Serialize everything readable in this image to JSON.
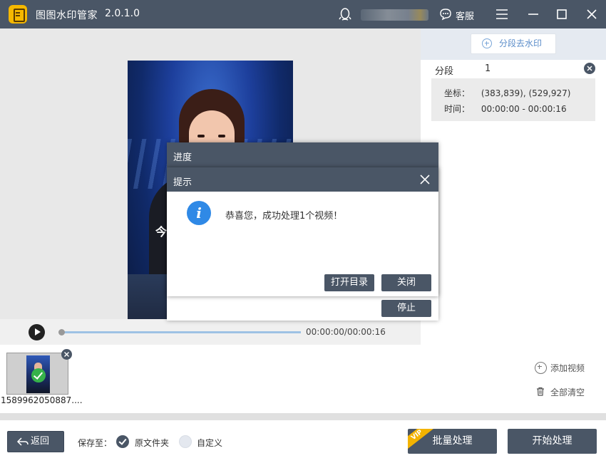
{
  "titlebar": {
    "app_name": "图图水印管家",
    "version": "2.0.1.0",
    "service_label": "客服",
    "qq_icon": "qq-penguin-icon",
    "service_icon": "chat-bubble-icon"
  },
  "right_panel": {
    "segment_button": "分段去水印",
    "segment_label": "分段",
    "segment_number": "1",
    "coord_key": "坐标：",
    "coord_value": "(383,839), (529,927)",
    "time_key": "时间：",
    "time_value": "00:00:00 - 00:00:16"
  },
  "preview": {
    "caption_char": "今"
  },
  "player": {
    "time_readout": "00:00:00/00:00:16"
  },
  "progress_dialog": {
    "title": "进度",
    "stop_label": "停止"
  },
  "message_dialog": {
    "title": "提示",
    "message": "恭喜您，成功处理1个视频！",
    "open_dir_label": "打开目录",
    "close_label": "关闭",
    "info_icon": "i"
  },
  "file_list": {
    "items": [
      {
        "name": "1589962050887...."
      }
    ],
    "add_video_label": "添加视频",
    "clear_all_label": "全部清空"
  },
  "footer": {
    "back_label": "返回",
    "save_to_label": "保存至：",
    "option_original": "原文件夹",
    "option_custom": "自定义",
    "selected_option": "原文件夹",
    "batch_label": "批量处理",
    "vip_badge": "VIP",
    "start_label": "开始处理"
  },
  "colors": {
    "header": "#4a5666",
    "accent_blue": "#2f89e6",
    "success_green": "#36b24a",
    "vip_gold": "#f3b300"
  }
}
